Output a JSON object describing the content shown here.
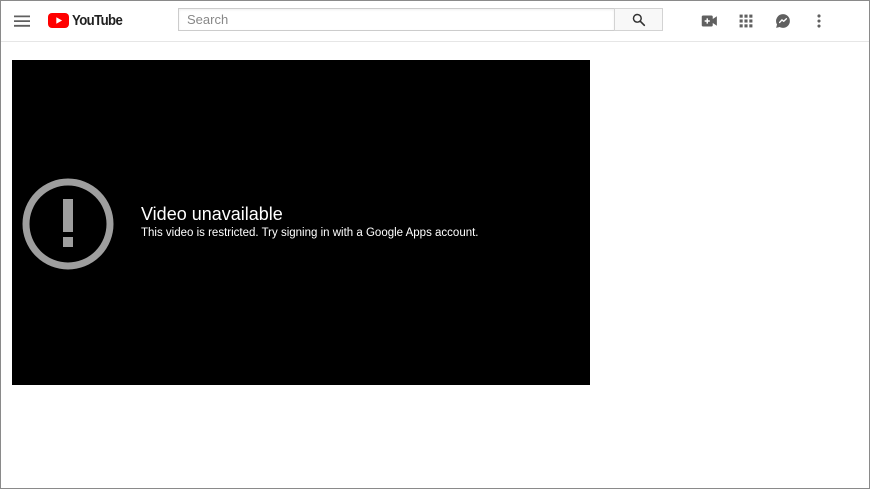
{
  "masthead": {
    "menu_icon": "hamburger-menu-icon",
    "logo_text": "YouTube",
    "logo_color": "#FF0000",
    "search_placeholder": "Search",
    "search_icon": "search-icon",
    "upload_icon": "video-camera-icon",
    "apps_icon": "apps-grid-icon",
    "messages_icon": "chat-bubble-icon",
    "more_icon": "vertical-dots-icon"
  },
  "player": {
    "background": "#000000",
    "error_icon": "exclamation-circle-icon",
    "error_icon_color": "#9E9E9E",
    "error_title": "Video unavailable",
    "error_reason": "This video is restricted. Try signing in with a Google Apps account."
  }
}
